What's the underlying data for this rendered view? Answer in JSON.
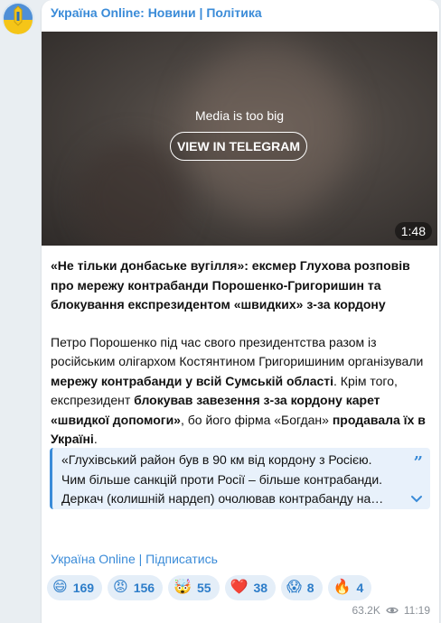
{
  "channel": {
    "name": "Україна Online: Новини | Політика",
    "avatar_icon": "ukraine-flag-avatar-icon"
  },
  "media": {
    "note": "Media is too big",
    "button_label": "VIEW IN TELEGRAM",
    "duration": "1:48"
  },
  "post": {
    "headline": "«Не тільки донбаське вугілля»: ексмер Глухова розповів про мережу контрабанди Порошенко-Григоришин та блокування експрезидентом «швидких» з-за кордону",
    "body": {
      "p1": "Петро Порошенко під час свого президентства разом із російським олігархом Костянтином Григоришиним організували ",
      "p2_bold": "мережу контрабанди у всій Сумській області",
      "p3": ". Крім того, експрезидент ",
      "p4_bold": "блокував завезення з-за кордону карет «швидкої допомоги»",
      "p5": ", бо його фірма «Богдан» ",
      "p6_bold": "продавала їх в Україні",
      "p7": "."
    },
    "quote_lines": [
      "«Глухівський район був в 90 км від кордону з Росією.",
      "Чим більше санкцій проти Росії – більше контрабанди.",
      "Деркач (колишній нардеп) очолював контрабанду на…"
    ],
    "quote_mark": "”"
  },
  "footer": {
    "subscribe_link": "Україна Online | Підписатись"
  },
  "reactions": [
    {
      "emoji": "😄",
      "icon": "grinning-face-icon",
      "count": "169"
    },
    {
      "emoji": "😡",
      "icon": "angry-face-icon",
      "count": "156"
    },
    {
      "emoji": "🤯",
      "icon": "exploding-head-icon",
      "count": "55"
    },
    {
      "emoji": "❤️",
      "icon": "red-heart-icon",
      "count": "38"
    },
    {
      "emoji": "😱",
      "icon": "screaming-face-icon",
      "count": "8"
    },
    {
      "emoji": "🔥",
      "icon": "fire-icon",
      "count": "4"
    }
  ],
  "meta": {
    "views": "63.2K",
    "views_icon": "eye-icon",
    "time": "11:19"
  },
  "colors": {
    "accent": "#3a8bd8",
    "background": "#e9eef2",
    "reaction_bg": "#e4eef8"
  }
}
